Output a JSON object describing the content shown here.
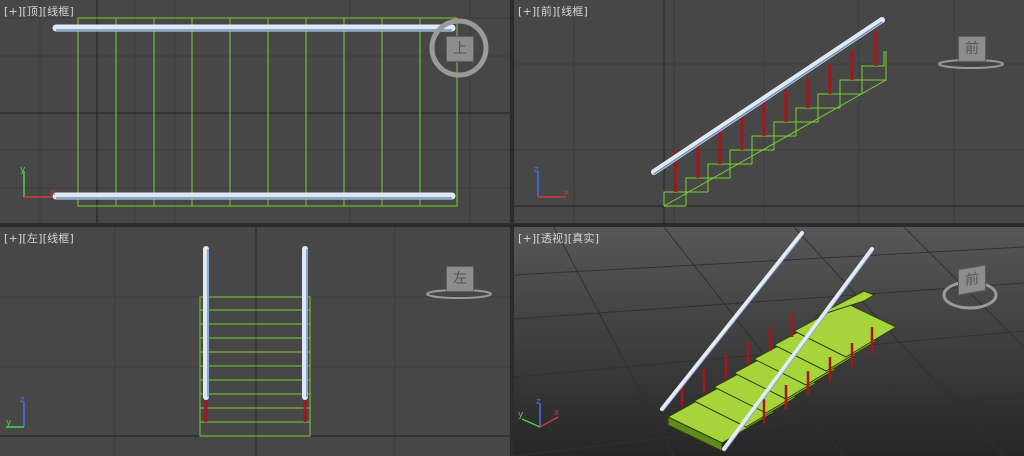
{
  "viewports": {
    "top": {
      "label_plus": "[+]",
      "label_view": "[顶]",
      "label_mode": "[线框]",
      "cube_face": "上"
    },
    "front": {
      "label_plus": "[+]",
      "label_view": "[前]",
      "label_mode": "[线框]",
      "cube_face": "前"
    },
    "left": {
      "label_plus": "[+]",
      "label_view": "[左]",
      "label_mode": "[线框]",
      "cube_face": "左"
    },
    "persp": {
      "label_plus": "[+]",
      "label_view": "[透视]",
      "label_mode": "[真实]",
      "cube_face": "前"
    }
  },
  "axis_letters": {
    "x": "x",
    "y": "y",
    "z": "z"
  },
  "colors": {
    "viewport_bg": "#474747",
    "grid": "#3a3a3a",
    "grid_axis": "#1f1f1f",
    "wire_green": "#7ad12b",
    "rail_blue": "#bcd2ee",
    "post_red": "#a8141a",
    "active_border": "#b19a55"
  }
}
